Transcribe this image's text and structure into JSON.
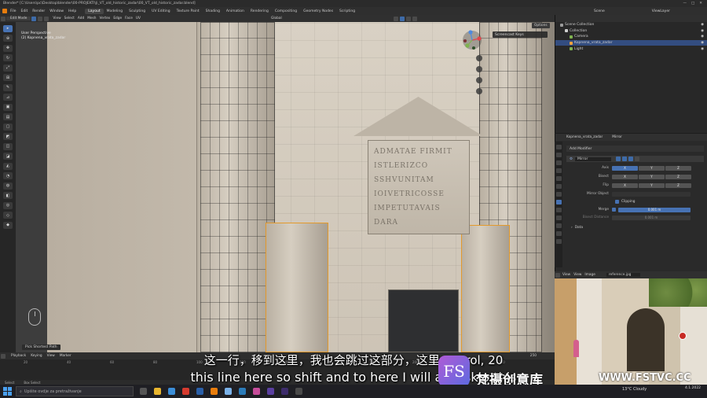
{
  "window": {
    "title": "Blender* [C:\\Users\\pc\\Desktop\\blender\\00-PROJEKTI\\Ji_VT_old_historic_zadar\\00_VT_old_historic_zadar.blend]",
    "controls": [
      "—",
      "□",
      "✕"
    ]
  },
  "menu": [
    "File",
    "Edit",
    "Render",
    "Window",
    "Help"
  ],
  "workspaces": [
    "Layout",
    "Modeling",
    "Sculpting",
    "UV Editing",
    "Texture Paint",
    "Shading",
    "Animation",
    "Rendering",
    "Compositing",
    "Geometry Nodes",
    "Scripting"
  ],
  "active_workspace": "Layout",
  "scene": {
    "label": "Scene",
    "view_layer": "ViewLayer"
  },
  "viewport_header": {
    "mode": "Edit Mode",
    "menus": [
      "View",
      "Select",
      "Add",
      "Mesh",
      "Vertex",
      "Edge",
      "Face",
      "UV"
    ],
    "orientation": "Global",
    "options": "Options"
  },
  "viewport": {
    "perspective": "User Perspective",
    "object": "(2) Kopnena_vrata_zadar",
    "screencast": "Screencast Keys",
    "inscription": [
      "ADMATAE FIRMIT",
      "ISTLERIZCO",
      "SSHVUNITAM",
      "IOIVETRICOSSE",
      "IMPETUTAVAIS",
      "DARA"
    ],
    "pick_path": "Pick Shortest Path"
  },
  "timeline": {
    "menus": [
      "Playback",
      "Keying",
      "View",
      "Marker"
    ],
    "frame": "250",
    "ruler": [
      "20",
      "40",
      "60",
      "80",
      "100",
      "120",
      "140",
      "160",
      "180",
      "200",
      "220",
      "240"
    ]
  },
  "status_bar": [
    "Select",
    "Box Select"
  ],
  "outliner": {
    "rows": [
      {
        "label": "Scene Collection",
        "color": "#9b9b9b",
        "selected": false,
        "indent": 0
      },
      {
        "label": "Collection",
        "color": "#cfcfcf",
        "selected": false,
        "indent": 1
      },
      {
        "label": "Camera",
        "color": "#7fb34f",
        "selected": false,
        "indent": 2
      },
      {
        "label": "Kopnena_vrata_zadar",
        "color": "#f2a23c",
        "selected": true,
        "indent": 2
      },
      {
        "label": "Light",
        "color": "#7fb34f",
        "selected": false,
        "indent": 2
      }
    ]
  },
  "properties": {
    "object": "Kopnena_vrata_zadar",
    "modifier_stack": "Mirror",
    "add_modifier": "Add Modifier",
    "modifier_name": "Mirror",
    "axis_rows": [
      {
        "label": "Axis",
        "values": [
          "X",
          "Y",
          "Z"
        ],
        "active": [
          true,
          false,
          false
        ]
      },
      {
        "label": "Bisect",
        "values": [
          "X",
          "Y",
          "Z"
        ],
        "active": [
          false,
          false,
          false
        ]
      },
      {
        "label": "Flip",
        "values": [
          "X",
          "Y",
          "Z"
        ],
        "active": [
          false,
          false,
          false
        ]
      }
    ],
    "mirror_object": "Mirror Object",
    "clipping": "Clipping",
    "merge_label": "Merge",
    "merge_value": "0.001 m",
    "bisect_distance_label": "Bisect Distance",
    "bisect_distance_value": "0.001 m",
    "data": "Data"
  },
  "image_editor": {
    "menus": [
      "View",
      "View",
      "Image"
    ],
    "image_name": "reference.jpg"
  },
  "subtitles": {
    "chinese": "这一行，移到这里，我也会跳过这部分，这里control, 20",
    "english": "this line here so shift and to here I will  also skip this"
  },
  "watermark": {
    "logo": "FS",
    "brand": "梵摄创意库",
    "url": "WWW.FSTVC.CC"
  },
  "taskbar": {
    "search_placeholder": "Upište ovdje za pretraživanje",
    "weather": "13°C  Cloudy",
    "time": "",
    "date": "4.1.2022"
  }
}
